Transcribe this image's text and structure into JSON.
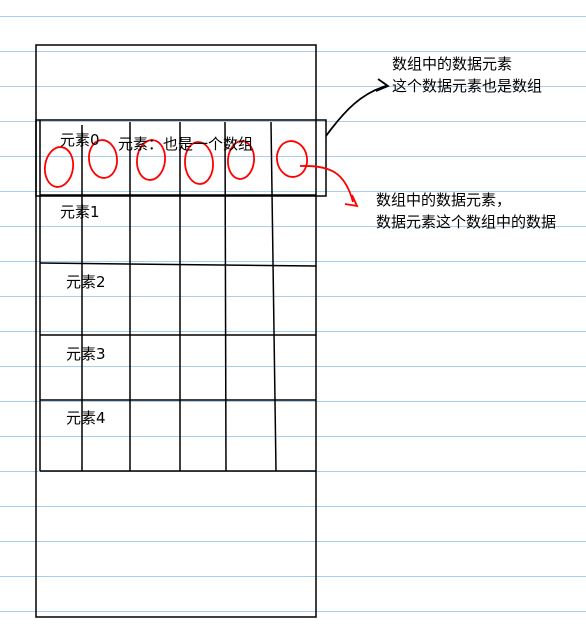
{
  "rows": {
    "row0": "元素0",
    "row1": "元素1",
    "row2": "元素2",
    "row3": "元素3",
    "row4": "元素4"
  },
  "row0_inner": "元素：也是一个数组",
  "note_top": {
    "line1": "数组中的数据元素",
    "line2": "这个数据元素也是数组"
  },
  "note_mid": {
    "line1": "数组中的数据元素，",
    "line2": "数据元素这个数组中的数据"
  },
  "colors": {
    "ruled_line": "#a9cdee",
    "ink": "#000000",
    "marker": "#ff0000"
  }
}
